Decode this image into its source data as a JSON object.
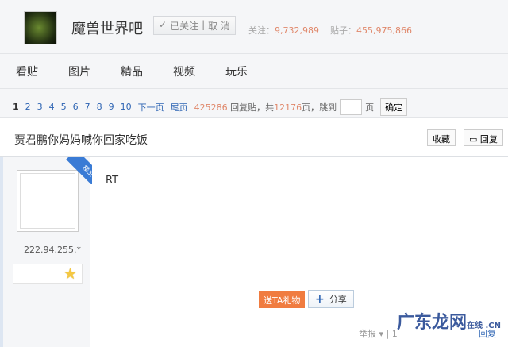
{
  "header": {
    "forum_name": "魔兽世界吧",
    "followed_label": "已关注",
    "unfollow_label": "取 消",
    "follow_label": "关注：",
    "follow_count": "9,732,989",
    "posts_label": "贴子：",
    "posts_count": "455,975,866"
  },
  "nav": [
    "看贴",
    "图片",
    "精品",
    "视频",
    "玩乐"
  ],
  "pager": {
    "current": "1",
    "pages": [
      "2",
      "3",
      "4",
      "5",
      "6",
      "7",
      "8",
      "9",
      "10"
    ],
    "next": "下一页",
    "last": "尾页",
    "reply_count": "425286",
    "reply_text": "回复贴，共",
    "page_count": "12176",
    "jump_text": "页，跳到",
    "page_unit": "页",
    "confirm": "确定"
  },
  "thread": {
    "title": "贾君鹏你妈妈喊你回家吃饭",
    "collect": "收藏",
    "reply": "回复"
  },
  "post": {
    "badge": "楼主",
    "ip": "222.94.255.*",
    "content": "RT",
    "gift": "送TA礼物",
    "share": "分享",
    "report": "举报",
    "floor": "1",
    "reply": "回复"
  },
  "watermark": {
    "text": "广东龙网",
    "suffix": "在线 .CN"
  },
  "colors": {
    "accent": "#2d64b3",
    "orange": "#e0886b",
    "gift": "#f07c40"
  }
}
